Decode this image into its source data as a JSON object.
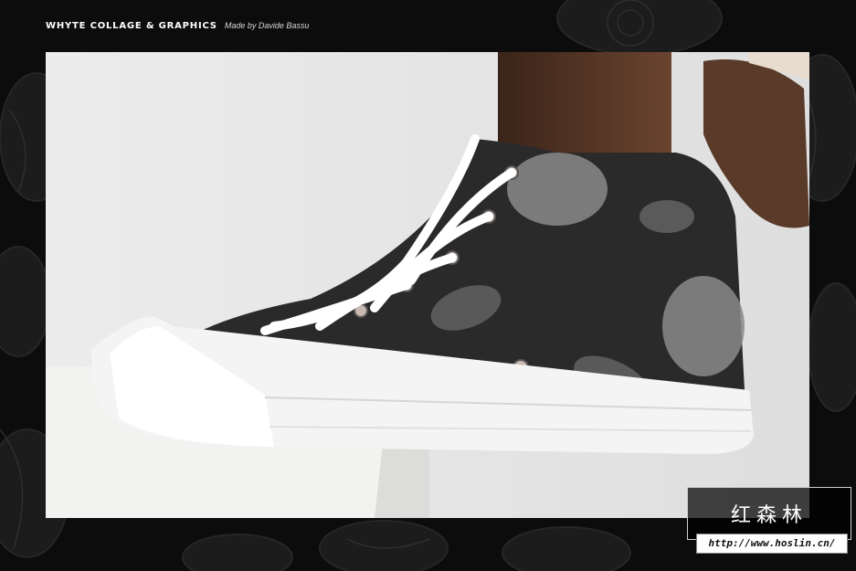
{
  "header": {
    "brand": "WHYTE COLLAGE & GRAPHICS",
    "byline": "Made by Davide Bassu"
  },
  "photo": {
    "subject": "high-top-sneaker-floral-print"
  },
  "watermark": {
    "chinese_text": "红森林",
    "url": "http://www.hoslin.cn/"
  },
  "colors": {
    "background": "#0c0c0c",
    "backdrop": "#e6e6e6",
    "shoe_canvas": "#2a2a2a",
    "sole": "#f4f4f4"
  }
}
